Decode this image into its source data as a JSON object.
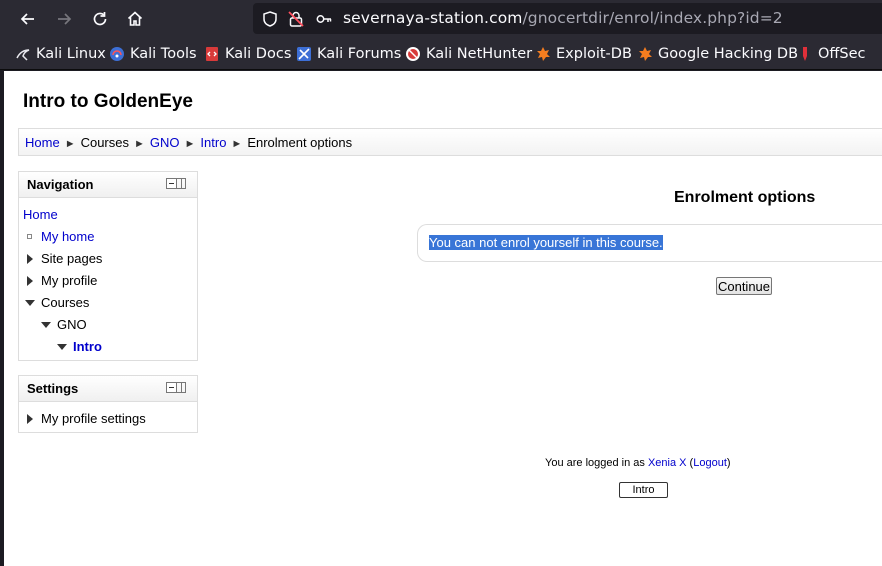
{
  "browser": {
    "url_domain": "severnaya-station.com",
    "url_path": "/gnocertdir/enrol/index.php?id=2",
    "bookmarks": [
      {
        "label": "Kali Linux",
        "icon": "kali-dragon-icon"
      },
      {
        "label": "Kali Tools",
        "icon": "kali-tools-icon"
      },
      {
        "label": "Kali Docs",
        "icon": "kali-docs-icon"
      },
      {
        "label": "Kali Forums",
        "icon": "kali-forums-icon"
      },
      {
        "label": "Kali NetHunter",
        "icon": "nethunter-icon"
      },
      {
        "label": "Exploit-DB",
        "icon": "exploit-db-icon"
      },
      {
        "label": "Google Hacking DB",
        "icon": "ghdb-icon"
      },
      {
        "label": "OffSec",
        "icon": "offsec-icon"
      }
    ]
  },
  "page": {
    "title": "Intro to GoldenEye",
    "breadcrumb": {
      "home": "Home",
      "courses": "Courses",
      "gno": "GNO",
      "intro": "Intro",
      "current": "Enrolment options",
      "separator": "►"
    },
    "navigation": {
      "title": "Navigation",
      "home": "Home",
      "my_home": "My home",
      "site_pages": "Site pages",
      "my_profile": "My profile",
      "courses": "Courses",
      "gno": "GNO",
      "intro": "Intro"
    },
    "settings": {
      "title": "Settings",
      "my_profile_settings": "My profile settings"
    },
    "main": {
      "heading": "Enrolment options",
      "notice": "You can not enrol yourself in this course.",
      "continue_label": "Continue"
    },
    "footer": {
      "logged_in_prefix": "You are logged in as",
      "user_name": "Xenia X",
      "logout_label": "Logout",
      "course_button": "Intro"
    }
  },
  "colors": {
    "link": "#0000cc",
    "selection": "#3875d7",
    "chrome_bg": "#2b2a33"
  }
}
